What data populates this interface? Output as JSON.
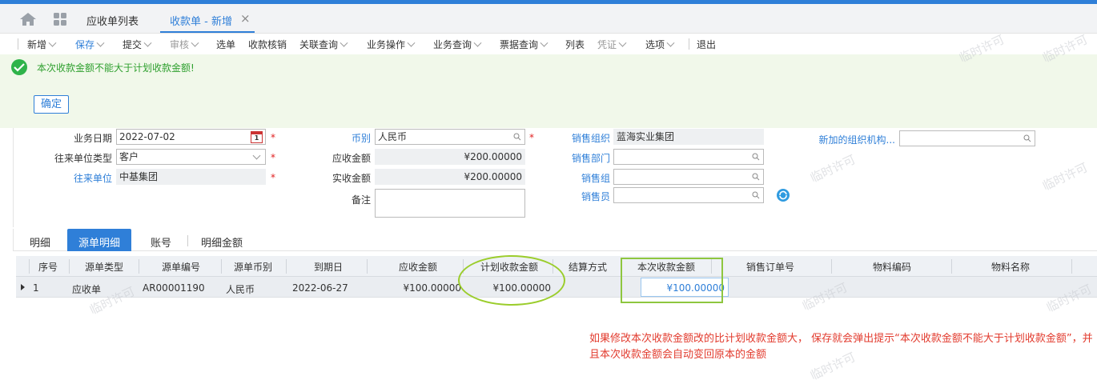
{
  "tabs": {
    "list": "应收单列表",
    "current": "收款单 - 新增",
    "close": "×"
  },
  "toolbar": {
    "new": "新增",
    "save": "保存",
    "submit": "提交",
    "audit": "审核",
    "select": "选单",
    "writeoff": "收款核销",
    "related": "关联查询",
    "ops": "业务操作",
    "query": "业务查询",
    "bill_query": "票据查询",
    "list": "列表",
    "voucher": "凭证",
    "options": "选项",
    "exit": "退出"
  },
  "message": {
    "text": "本次收款金额不能大于计划收款金额!",
    "ok": "确定"
  },
  "form": {
    "biz_date_label": "业务日期",
    "biz_date": "2022-07-02",
    "cal_day": "1",
    "unit_type_label": "往来单位类型",
    "unit_type": "客户",
    "unit_label": "往来单位",
    "unit": "中基集团",
    "currency_label": "币别",
    "currency": "人民币",
    "receivable_label": "应收金额",
    "receivable": "¥200.00000",
    "actual_label": "实收金额",
    "actual": "¥200.00000",
    "remark_label": "备注",
    "remark": "",
    "sales_org_label": "销售组织",
    "sales_org": "蓝海实业集团",
    "sales_dept_label": "销售部门",
    "sales_dept": "",
    "sales_group_label": "销售组",
    "sales_group": "",
    "salesman_label": "销售员",
    "salesman": "",
    "new_org_label": "新加的组织机构...",
    "new_org": "",
    "required": "*"
  },
  "subtabs": {
    "detail": "明细",
    "source": "源单明细",
    "account": "账号",
    "amount": "明细金额"
  },
  "table": {
    "headers": {
      "seq": "序号",
      "type": "源单类型",
      "no": "源单编号",
      "currency": "源单币别",
      "due": "到期日",
      "receivable": "应收金额",
      "plan": "计划收款金额",
      "method": "结算方式",
      "current": "本次收款金额",
      "order": "销售订单号",
      "mat_code": "物料编码",
      "mat_name": "物料名称"
    },
    "row": {
      "seq": "1",
      "type": "应收单",
      "no": "AR00001190",
      "currency": "人民币",
      "due": "2022-06-27",
      "receivable": "¥100.00000",
      "plan": "¥100.00000",
      "method": "",
      "current": "¥100.00000",
      "order": "",
      "mat_code": "",
      "mat_name": ""
    }
  },
  "note": "如果修改本次收款金额改的比计划收款金额大， 保存就会弹出提示“本次收款金额不能大于计划收款金额”，并且本次收款金额会自动变回原本的金额",
  "watermark": "临时许可"
}
